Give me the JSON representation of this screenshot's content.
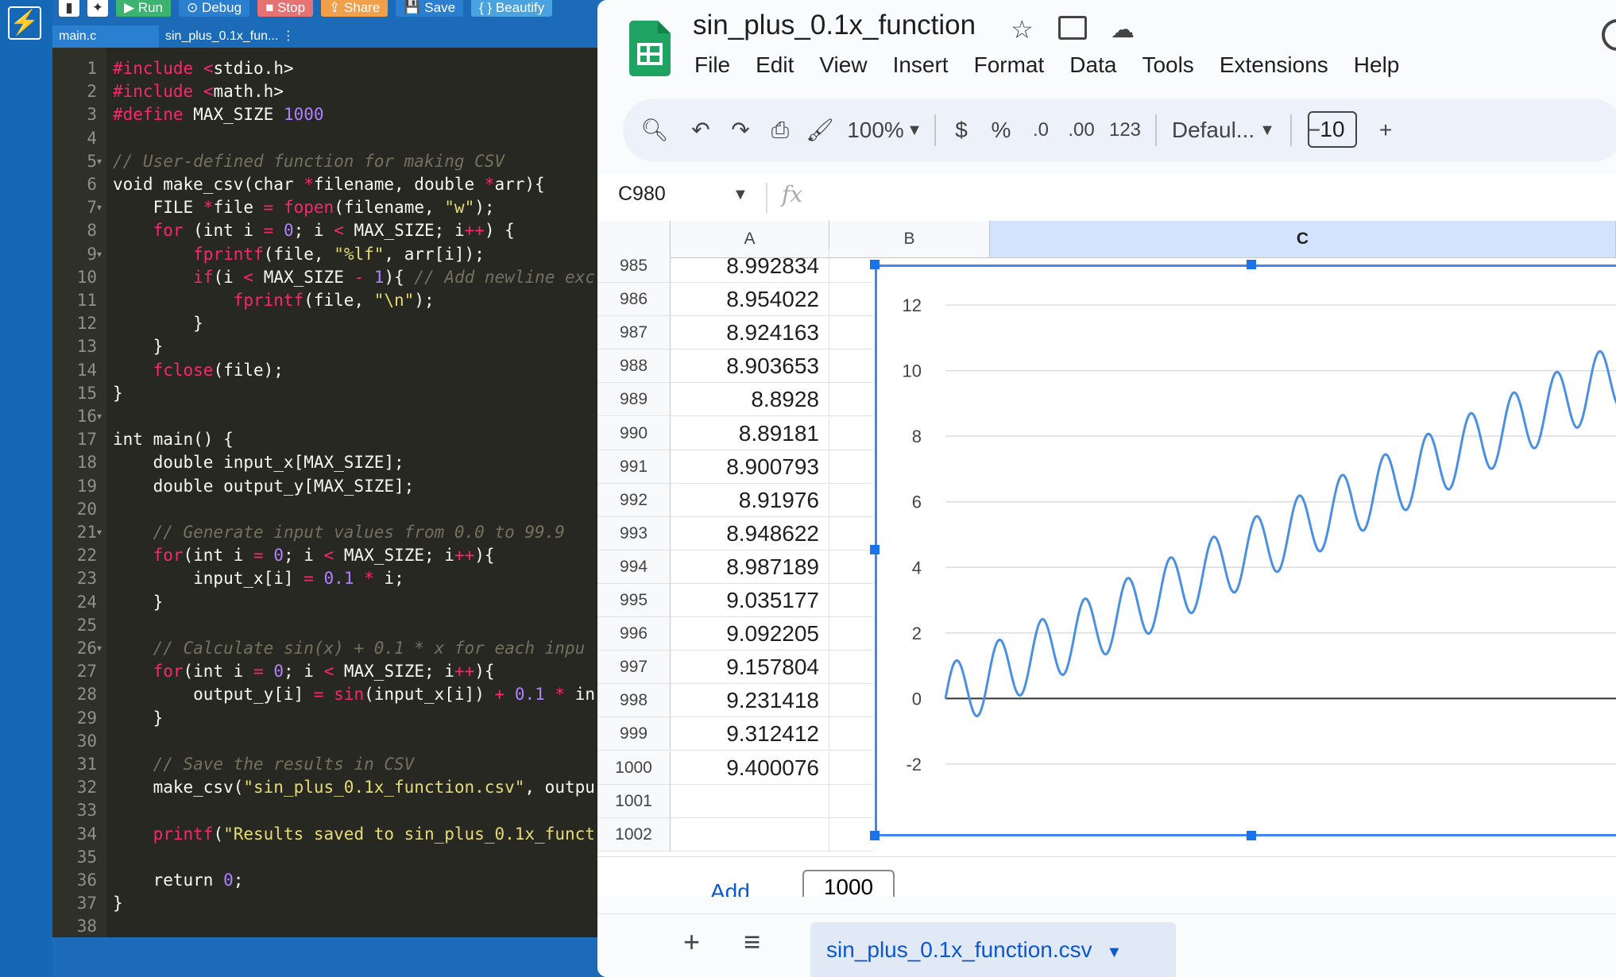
{
  "ide": {
    "toolbar": [
      "Run",
      "Debug",
      "Stop",
      "Share",
      "Save",
      "{ } Beautify"
    ],
    "tabs": [
      "main.c",
      "sin_plus_0.1x_fun..."
    ],
    "code_lines": [
      "#include <stdio.h>",
      "#include <math.h>",
      "#define MAX_SIZE 1000",
      "",
      "// User-defined function for making CSV",
      "void make_csv(char *filename, double *arr){",
      "    FILE *file = fopen(filename, \"w\");",
      "    for (int i = 0; i < MAX_SIZE; i++) {",
      "        fprintf(file, \"%lf\", arr[i]);",
      "        if(i < MAX_SIZE - 1){ // Add newline exc",
      "            fprintf(file, \"\\n\");",
      "        }",
      "    }",
      "    fclose(file);",
      "}",
      "",
      "int main() {",
      "    double input_x[MAX_SIZE];",
      "    double output_y[MAX_SIZE];",
      "",
      "    // Generate input values from 0.0 to 99.9",
      "    for(int i = 0; i < MAX_SIZE; i++){",
      "        input_x[i] = 0.1 * i;",
      "    }",
      "",
      "    // Calculate sin(x) + 0.1 * x for each inpu",
      "    for(int i = 0; i < MAX_SIZE; i++){",
      "        output_y[i] = sin(input_x[i]) + 0.1 * in",
      "    }",
      "",
      "    // Save the results in CSV",
      "    make_csv(\"sin_plus_0.1x_function.csv\", outpu",
      "",
      "    printf(\"Results saved to sin_plus_0.1x_funct",
      "",
      "    return 0;",
      "}",
      ""
    ]
  },
  "sheets": {
    "title": "sin_plus_0.1x_function",
    "menu": [
      "File",
      "Edit",
      "View",
      "Insert",
      "Format",
      "Data",
      "Tools",
      "Extensions",
      "Help"
    ],
    "toolbar": {
      "zoom": "100%",
      "currency": "$",
      "percent": "%",
      "dec_less": ".0",
      "dec_more": ".00",
      "format_num": "123",
      "font": "Defaul...",
      "font_size": "10"
    },
    "name_box": "C980",
    "fx": "fx",
    "columns": [
      "A",
      "B",
      "C"
    ],
    "rows": [
      {
        "n": "985",
        "a": "8.992834"
      },
      {
        "n": "986",
        "a": "8.954022"
      },
      {
        "n": "987",
        "a": "8.924163"
      },
      {
        "n": "988",
        "a": "8.903653"
      },
      {
        "n": "989",
        "a": "8.8928"
      },
      {
        "n": "990",
        "a": "8.89181"
      },
      {
        "n": "991",
        "a": "8.900793"
      },
      {
        "n": "992",
        "a": "8.91976"
      },
      {
        "n": "993",
        "a": "8.948622"
      },
      {
        "n": "994",
        "a": "8.987189"
      },
      {
        "n": "995",
        "a": "9.035177"
      },
      {
        "n": "996",
        "a": "9.092205"
      },
      {
        "n": "997",
        "a": "9.157804"
      },
      {
        "n": "998",
        "a": "9.231418"
      },
      {
        "n": "999",
        "a": "9.312412"
      },
      {
        "n": "1000",
        "a": "9.400076"
      },
      {
        "n": "1001",
        "a": ""
      },
      {
        "n": "1002",
        "a": ""
      }
    ],
    "add_more": {
      "label": "Add",
      "value": "1000"
    },
    "sheet_tab": "sin_plus_0.1x_function.csv",
    "accent": "#4285f4"
  },
  "chart_data": {
    "type": "line",
    "ylim": [
      -2,
      12
    ],
    "yticks": [
      -2,
      0,
      2,
      4,
      6,
      8,
      10,
      12
    ],
    "series": [
      {
        "function": "sin(x) + 0.1*x",
        "x_range": [
          0,
          99.9
        ],
        "samples": 1000,
        "color": "#4a90e2"
      }
    ],
    "grid": true
  }
}
